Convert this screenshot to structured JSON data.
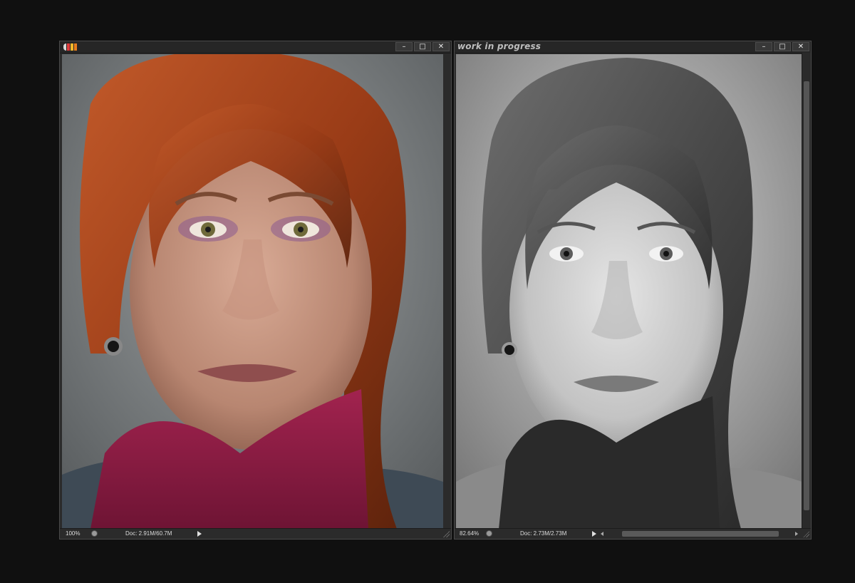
{
  "left_window": {
    "logo_colors": [
      "#d9d9d9",
      "#e23c3c",
      "#f7b82b",
      "#e87d1e"
    ],
    "buttons": {
      "minimize": "–",
      "maximize": "□",
      "close": "✕"
    },
    "status": {
      "zoom": "100%",
      "doc": "Doc: 2.91M/60.7M"
    }
  },
  "right_window": {
    "title": "work in progress",
    "buttons": {
      "minimize": "–",
      "maximize": "□",
      "close": "✕"
    },
    "status": {
      "zoom": "82.64%",
      "doc": "Doc: 2.73M/2.73M"
    }
  }
}
